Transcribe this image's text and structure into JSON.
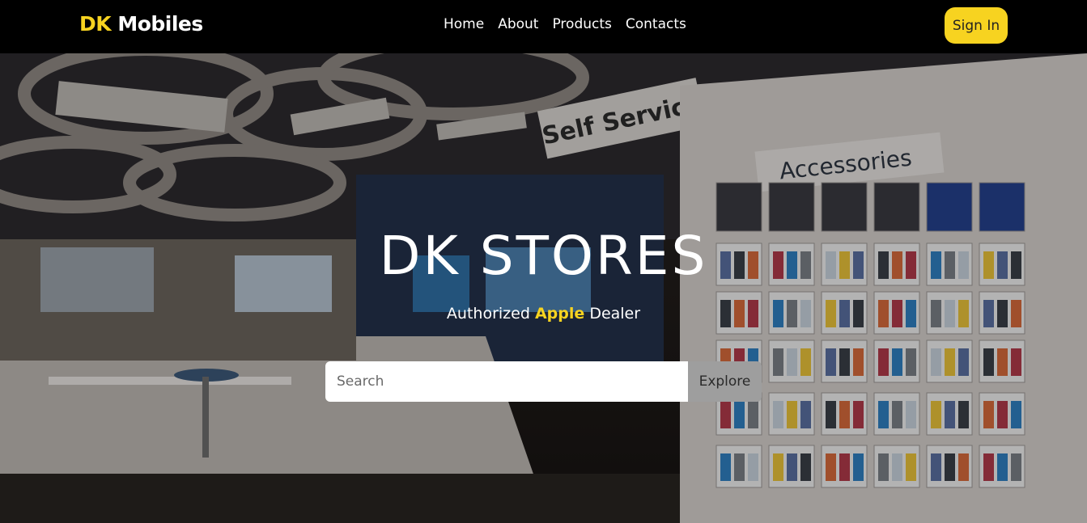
{
  "nav": {
    "logo_accent": "DK",
    "logo_text": "Mobiles",
    "links": [
      "Home",
      "About",
      "Products",
      "Contacts"
    ],
    "signin_label": "Sign In"
  },
  "hero": {
    "title": "DK STORES",
    "subtitle_prefix": "Authorized",
    "subtitle_brand": "Apple",
    "subtitle_suffix": "Dealer",
    "search_placeholder": "Search",
    "explore_label": "Explore",
    "sign_self_service": "Self Service",
    "sign_accessories": "Accessories"
  },
  "colors": {
    "accent": "#f7d320",
    "navbar": "#000000",
    "explore_button": "#9e9e9e"
  }
}
